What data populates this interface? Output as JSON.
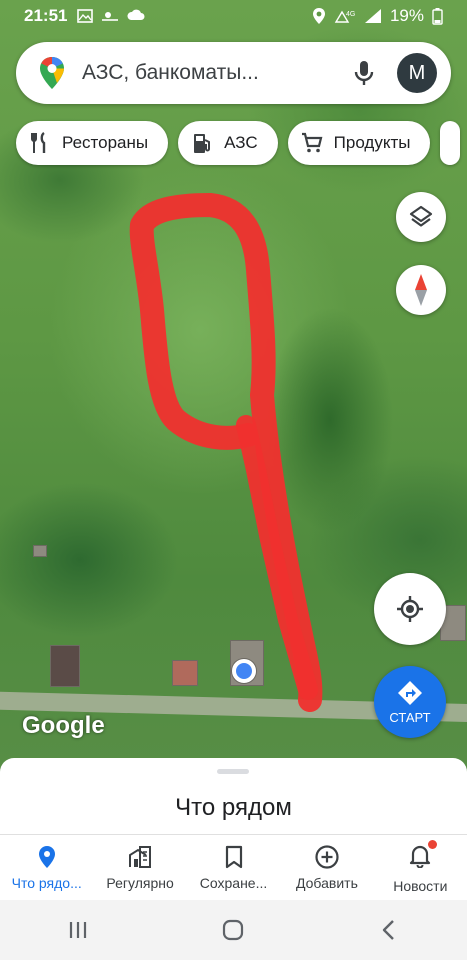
{
  "status_bar": {
    "time": "21:51",
    "battery": "19%"
  },
  "search": {
    "query": "АЗС, банкоматы...",
    "avatar_letter": "М"
  },
  "chips": [
    {
      "label": "Рестораны",
      "icon": "restaurant-icon"
    },
    {
      "label": "АЗС",
      "icon": "gas-station-icon"
    },
    {
      "label": "Продукты",
      "icon": "cart-icon"
    }
  ],
  "map": {
    "layers_icon": "layers-icon",
    "compass_icon": "compass-icon",
    "locate_icon": "my-location-icon",
    "logo_text": "Google",
    "drawing_color": "#f0302e"
  },
  "start_button": {
    "label": "СТАРТ",
    "color": "#1a73e8"
  },
  "sheet": {
    "title": "Что рядом"
  },
  "bottom_nav": [
    {
      "label": "Что рядо...",
      "icon": "explore-pin-icon",
      "active": true
    },
    {
      "label": "Регулярно",
      "icon": "commute-icon",
      "active": false
    },
    {
      "label": "Сохране...",
      "icon": "bookmark-icon",
      "active": false
    },
    {
      "label": "Добавить",
      "icon": "add-circle-icon",
      "active": false
    },
    {
      "label": "Новости",
      "icon": "bell-icon",
      "active": false
    }
  ],
  "accent_color": "#1a73e8"
}
